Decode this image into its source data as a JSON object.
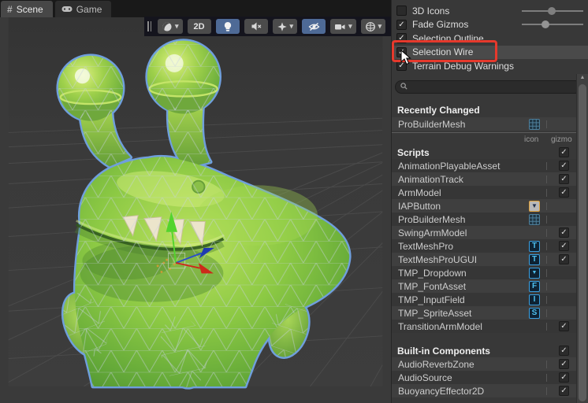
{
  "window": {
    "app": "Unity Scene View with Gizmos dropdown"
  },
  "colors": {
    "selection_outline_blue": "#6f9fdd",
    "annotation_red": "#e6392c",
    "active_toolbar_blue": "#4e6a96",
    "gizmo_axis_red": "#cc2a1a",
    "gizmo_axis_green": "#53d42e",
    "gizmo_axis_blue": "#2b4fc9",
    "tmp_icon_blue": "#4fc1f0",
    "iap_icon_border_orange": "#e0a23c",
    "panel_bg": "#383838"
  },
  "tabs": [
    {
      "label": "Scene",
      "icon": "grid-icon",
      "icon_glyph": "#",
      "active": true
    },
    {
      "label": "Game",
      "icon": "gamepad-icon",
      "active": false
    }
  ],
  "toolbar": {
    "buttons": [
      {
        "name": "shading-mode",
        "icon": "shaded-sphere-icon",
        "has_caret": true,
        "active": false
      },
      {
        "name": "2d-toggle",
        "label": "2D",
        "active": false
      },
      {
        "name": "lighting-toggle",
        "icon": "lightbulb-icon",
        "active": true
      },
      {
        "name": "audio-toggle",
        "icon": "speaker-muted-icon",
        "active": false
      },
      {
        "name": "effects-toggle",
        "icon": "star-icon",
        "has_caret": true,
        "active": false
      },
      {
        "name": "visibility-toggle",
        "icon": "eye-hidden-icon",
        "active": true
      },
      {
        "name": "camera-settings",
        "icon": "camera-icon",
        "has_caret": true,
        "active": false
      },
      {
        "name": "component-tools",
        "icon": "gizmo-sphere-icon",
        "has_caret": true,
        "active": false
      }
    ],
    "label_2d": "2D",
    "caret": "▾"
  },
  "gizmos_panel": {
    "options": [
      {
        "label": "3D Icons",
        "check": "",
        "slider": 0.49
      },
      {
        "label": "Fade Gizmos",
        "check": "✓",
        "slider": 0.39
      },
      {
        "label": "Selection Outline",
        "check": "✓"
      },
      {
        "label": "Selection Wire",
        "check": "✓",
        "highlighted": true
      },
      {
        "label": "Terrain Debug Warnings",
        "check": "✓"
      }
    ],
    "search_placeholder": "",
    "columns": {
      "icon": "icon",
      "gizmo": "gizmo"
    },
    "recently_changed": {
      "header": "Recently Changed",
      "rows": [
        {
          "name": "ProBuilderMesh",
          "icon": "probuilder",
          "gizmo": ""
        }
      ]
    },
    "scripts": {
      "header": "Scripts",
      "header_check": "✓",
      "rows": [
        {
          "name": "AnimationPlayableAsset",
          "icon": "",
          "gizmo": "✓"
        },
        {
          "name": "AnimationTrack",
          "icon": "",
          "gizmo": "✓"
        },
        {
          "name": "ArmModel",
          "icon": "",
          "gizmo": "✓"
        },
        {
          "name": "IAPButton",
          "icon": "iap",
          "gizmo": ""
        },
        {
          "name": "ProBuilderMesh",
          "icon": "probuilder",
          "gizmo": ""
        },
        {
          "name": "SwingArmModel",
          "icon": "",
          "gizmo": "✓"
        },
        {
          "name": "TextMeshPro",
          "icon": "tmp-T",
          "gizmo": "✓"
        },
        {
          "name": "TextMeshProUGUI",
          "icon": "tmp-T",
          "gizmo": "✓"
        },
        {
          "name": "TMP_Dropdown",
          "icon": "tmp-dropdown",
          "gizmo": ""
        },
        {
          "name": "TMP_FontAsset",
          "icon": "tmp-F",
          "gizmo": ""
        },
        {
          "name": "TMP_InputField",
          "icon": "tmp-I",
          "gizmo": ""
        },
        {
          "name": "TMP_SpriteAsset",
          "icon": "tmp-S",
          "gizmo": ""
        },
        {
          "name": "TransitionArmModel",
          "icon": "",
          "gizmo": "✓"
        }
      ]
    },
    "builtin": {
      "header": "Built-in Components",
      "header_check": "✓",
      "rows": [
        {
          "name": "AudioReverbZone",
          "icon": "",
          "gizmo": "✓"
        },
        {
          "name": "AudioSource",
          "icon": "",
          "gizmo": "✓"
        },
        {
          "name": "BuoyancyEffector2D",
          "icon": "",
          "gizmo": "✓"
        }
      ]
    },
    "icon_glyphs": {
      "tmp-T": "T",
      "tmp-F": "F",
      "tmp-I": "I",
      "tmp-S": "S",
      "tmp-dropdown": "▼",
      "iap": "▼",
      "probuilder": ""
    }
  }
}
